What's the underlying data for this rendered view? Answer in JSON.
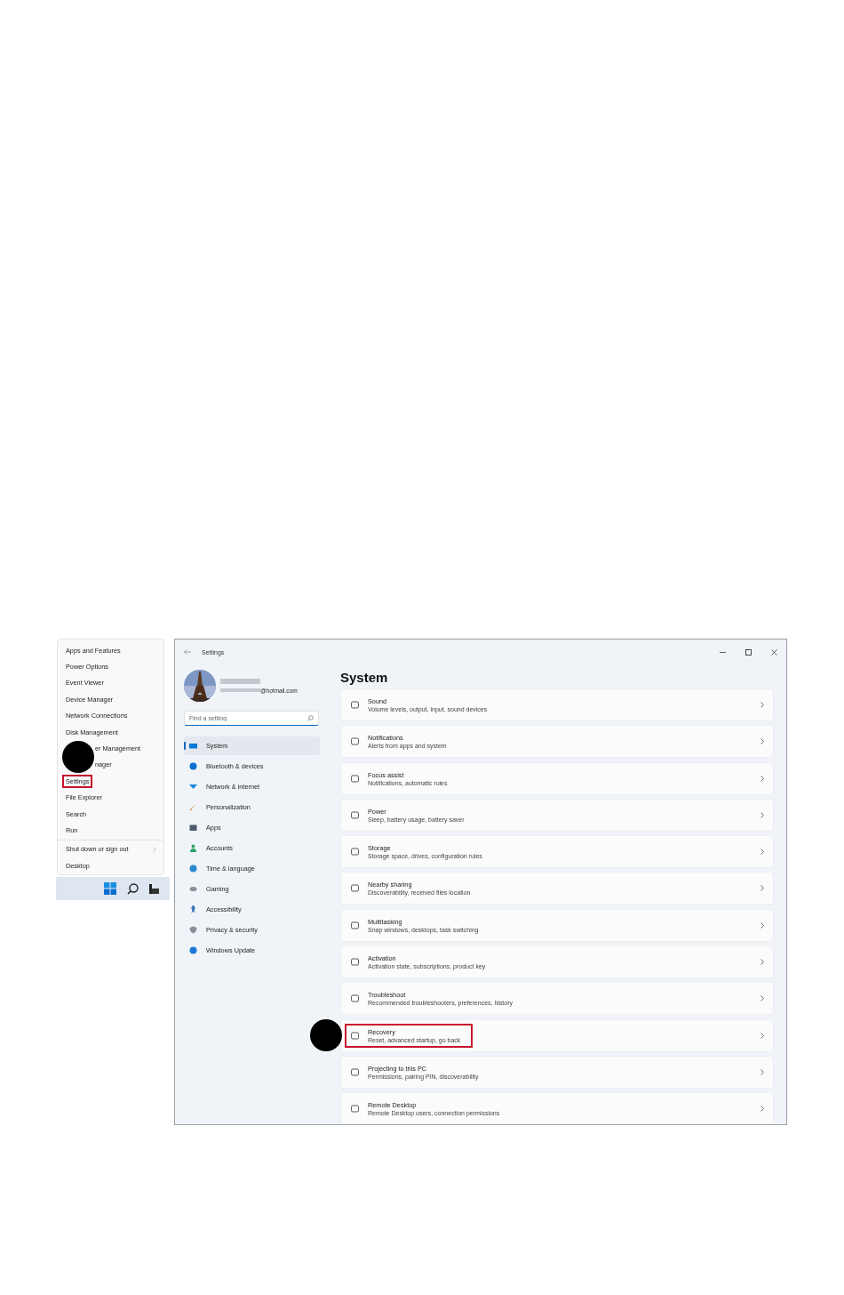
{
  "quick_menu": {
    "items": [
      {
        "label": "Apps and Features",
        "kind": "item",
        "highlighted": false,
        "marker": false
      },
      {
        "label": "Power Options",
        "kind": "item",
        "highlighted": false,
        "marker": false
      },
      {
        "label": "Event Viewer",
        "kind": "item",
        "highlighted": false,
        "marker": false
      },
      {
        "label": "Device Manager",
        "kind": "item",
        "highlighted": false,
        "marker": false
      },
      {
        "label": "Network Connections",
        "kind": "item",
        "highlighted": false,
        "marker": false
      },
      {
        "label": "Disk Management",
        "kind": "item",
        "highlighted": false,
        "marker": false
      },
      {
        "label": "er Management",
        "kind": "partial",
        "highlighted": false,
        "marker": true
      },
      {
        "label": "nager",
        "kind": "partial",
        "highlighted": false,
        "marker": false
      },
      {
        "label": "Settings",
        "kind": "item",
        "highlighted": true,
        "marker": false
      },
      {
        "label": "File Explorer",
        "kind": "item",
        "highlighted": false,
        "marker": false
      },
      {
        "label": "Search",
        "kind": "item",
        "highlighted": false,
        "marker": false
      },
      {
        "label": "Run",
        "kind": "item",
        "highlighted": false,
        "marker": false
      },
      {
        "label": "Shut down or sign out",
        "kind": "submenu",
        "highlighted": false,
        "marker": false
      },
      {
        "label": "Desktop",
        "kind": "item",
        "highlighted": false,
        "marker": false
      }
    ]
  },
  "window": {
    "title": "Settings"
  },
  "account": {
    "email": "@hotmail.com"
  },
  "search": {
    "placeholder": "Find a setting"
  },
  "sidebar": {
    "items": [
      {
        "label": "System",
        "selected": true
      },
      {
        "label": "Bluetooth & devices",
        "selected": false
      },
      {
        "label": "Network & internet",
        "selected": false
      },
      {
        "label": "Personalization",
        "selected": false
      },
      {
        "label": "Apps",
        "selected": false
      },
      {
        "label": "Accounts",
        "selected": false
      },
      {
        "label": "Time & language",
        "selected": false
      },
      {
        "label": "Gaming",
        "selected": false
      },
      {
        "label": "Accessibility",
        "selected": false
      },
      {
        "label": "Privacy & security",
        "selected": false
      },
      {
        "label": "Windows Update",
        "selected": false
      }
    ]
  },
  "page": {
    "title": "System",
    "items": [
      {
        "title": "Sound",
        "description": "Volume levels, output, input, sound devices",
        "highlighted": false,
        "marker": false
      },
      {
        "title": "Notifications",
        "description": "Alerts from apps and system",
        "highlighted": false,
        "marker": false
      },
      {
        "title": "Focus assist",
        "description": "Notifications, automatic rules",
        "highlighted": false,
        "marker": false
      },
      {
        "title": "Power",
        "description": "Sleep, battery usage, battery saver",
        "highlighted": false,
        "marker": false
      },
      {
        "title": "Storage",
        "description": "Storage space, drives, configuration rules",
        "highlighted": false,
        "marker": false
      },
      {
        "title": "Nearby sharing",
        "description": "Discoverability, received files location",
        "highlighted": false,
        "marker": false
      },
      {
        "title": "Multitasking",
        "description": "Snap windows, desktops, task switching",
        "highlighted": false,
        "marker": false
      },
      {
        "title": "Activation",
        "description": "Activation state, subscriptions, product key",
        "highlighted": false,
        "marker": false
      },
      {
        "title": "Troubleshoot",
        "description": "Recommended troubleshooters, preferences, history",
        "highlighted": false,
        "marker": false
      },
      {
        "title": "Recovery",
        "description": "Reset, advanced startup, go back",
        "highlighted": true,
        "marker": true
      },
      {
        "title": "Projecting to this PC",
        "description": "Permissions, pairing PIN, discoverability",
        "highlighted": false,
        "marker": false
      },
      {
        "title": "Remote Desktop",
        "description": "Remote Desktop users, connection permissions",
        "highlighted": false,
        "marker": false
      }
    ]
  }
}
